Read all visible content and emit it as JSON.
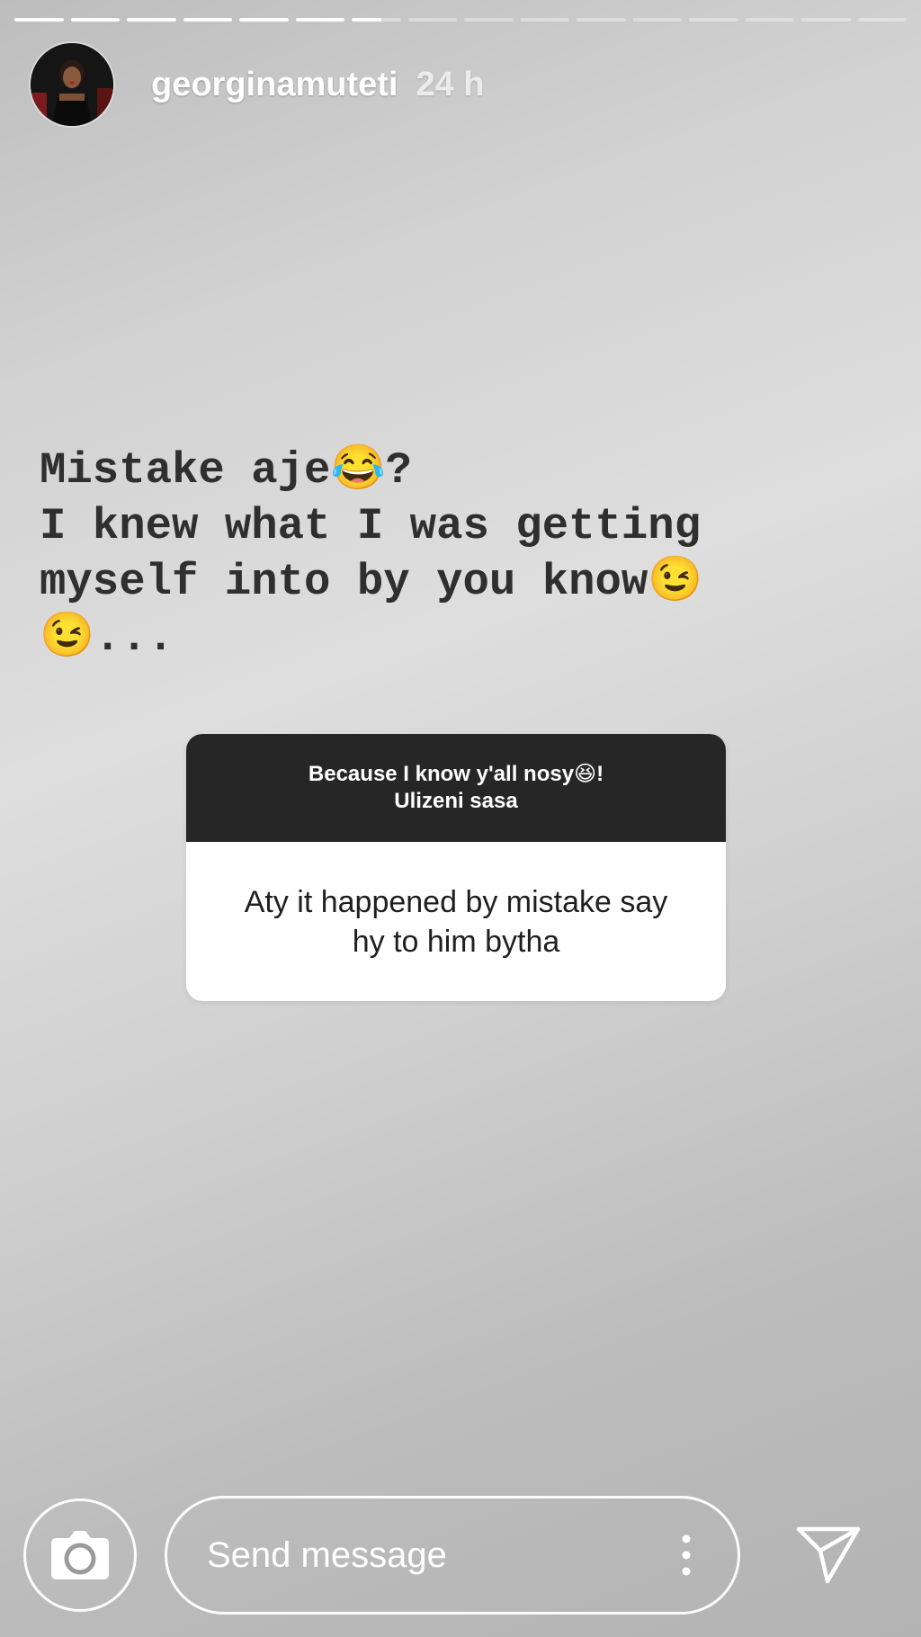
{
  "story": {
    "progress": {
      "total_segments": 16,
      "completed_segments": 6,
      "current_segment_fraction": 0.6
    }
  },
  "header": {
    "username": "georginamuteti",
    "time": "24 h"
  },
  "caption": {
    "lines": [
      "Mistake aje😂?",
      "I knew what I was getting",
      "myself into by you know😉",
      "😉..."
    ]
  },
  "question_sticker": {
    "prompt_line1": "Because I know y'all nosy😆!",
    "prompt_line2": "Ulizeni sasa",
    "answer_line1": "Aty it happened by mistake say",
    "answer_line2": "hy to him bytha"
  },
  "footer": {
    "message_placeholder": "Send message",
    "icons": [
      "camera-icon",
      "more-options-icon",
      "send-icon"
    ]
  },
  "colors": {
    "question_header_bg": "#262626",
    "caption_text": "#2f2f2f"
  }
}
